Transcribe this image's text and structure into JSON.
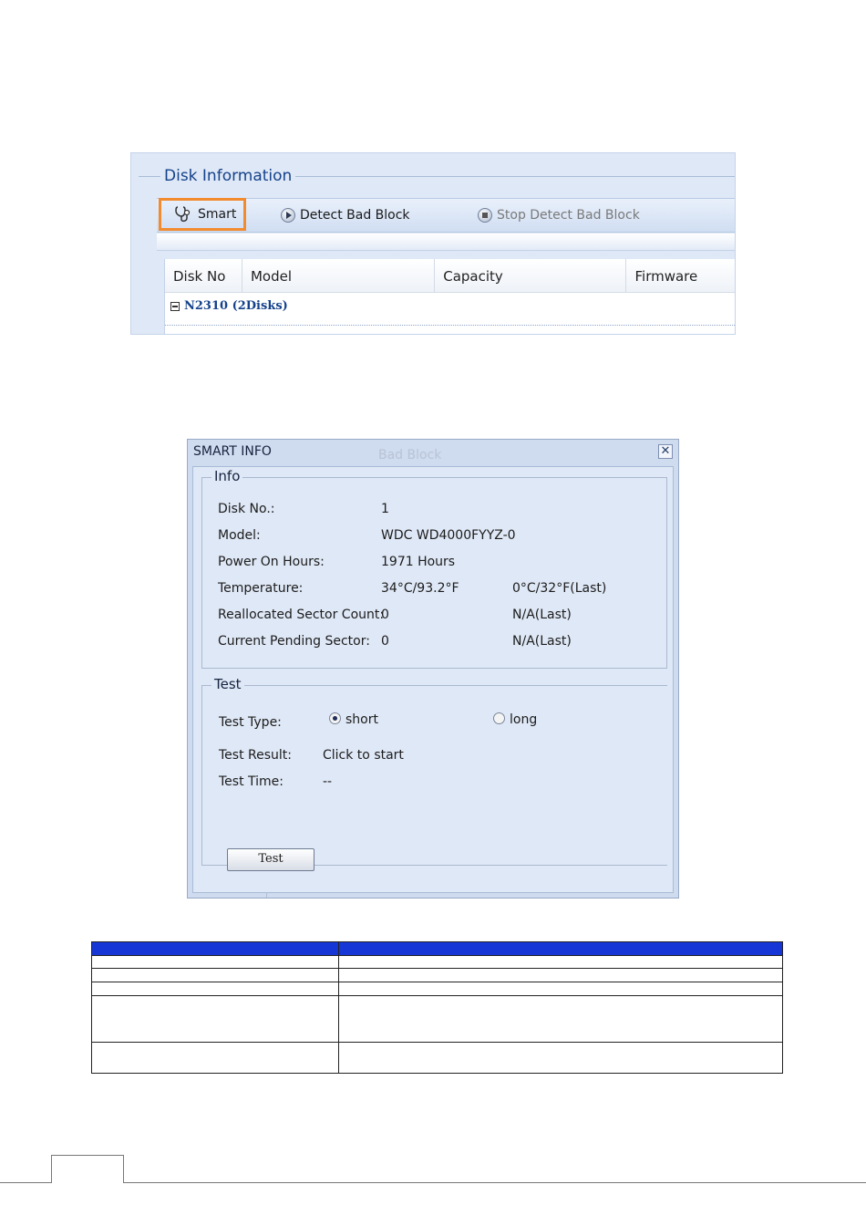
{
  "disk_panel": {
    "title": "Disk Information",
    "toolbar": {
      "smart_label": "Smart",
      "detect_label": "Detect Bad Block",
      "stop_label": "Stop Detect Bad Block"
    },
    "columns": [
      "Disk No",
      "Model",
      "Capacity",
      "Firmware"
    ],
    "group_label": "N2310 (2Disks)"
  },
  "dialog": {
    "title": "SMART INFO",
    "ghost_text": "Bad Block",
    "close_icon": "close-icon",
    "info": {
      "legend": "Info",
      "rows": [
        {
          "label": "Disk No.:",
          "value": "1",
          "last": ""
        },
        {
          "label": "Model:",
          "value": "WDC WD4000FYYZ-0",
          "last": ""
        },
        {
          "label": "Power On Hours:",
          "value": "1971 Hours",
          "last": ""
        },
        {
          "label": "Temperature:",
          "value": "34°C/93.2°F",
          "last": "0°C/32°F(Last)"
        },
        {
          "label": "Reallocated Sector Count:",
          "value": "0",
          "last": "N/A(Last)"
        },
        {
          "label": "Current Pending Sector:",
          "value": "0",
          "last": "N/A(Last)"
        }
      ]
    },
    "test": {
      "legend": "Test",
      "type_label": "Test Type:",
      "option_short": "short",
      "option_long": "long",
      "selected": "short",
      "result_label": "Test Result:",
      "result_value": "Click to start",
      "time_label": "Test Time:",
      "time_value": "--",
      "button_label": "Test"
    }
  },
  "colors": {
    "panel_bg": "#dfe8f6",
    "title_blue": "#15428b",
    "highlight_orange": "#f28a2e",
    "table_header_blue": "#1636d6"
  }
}
